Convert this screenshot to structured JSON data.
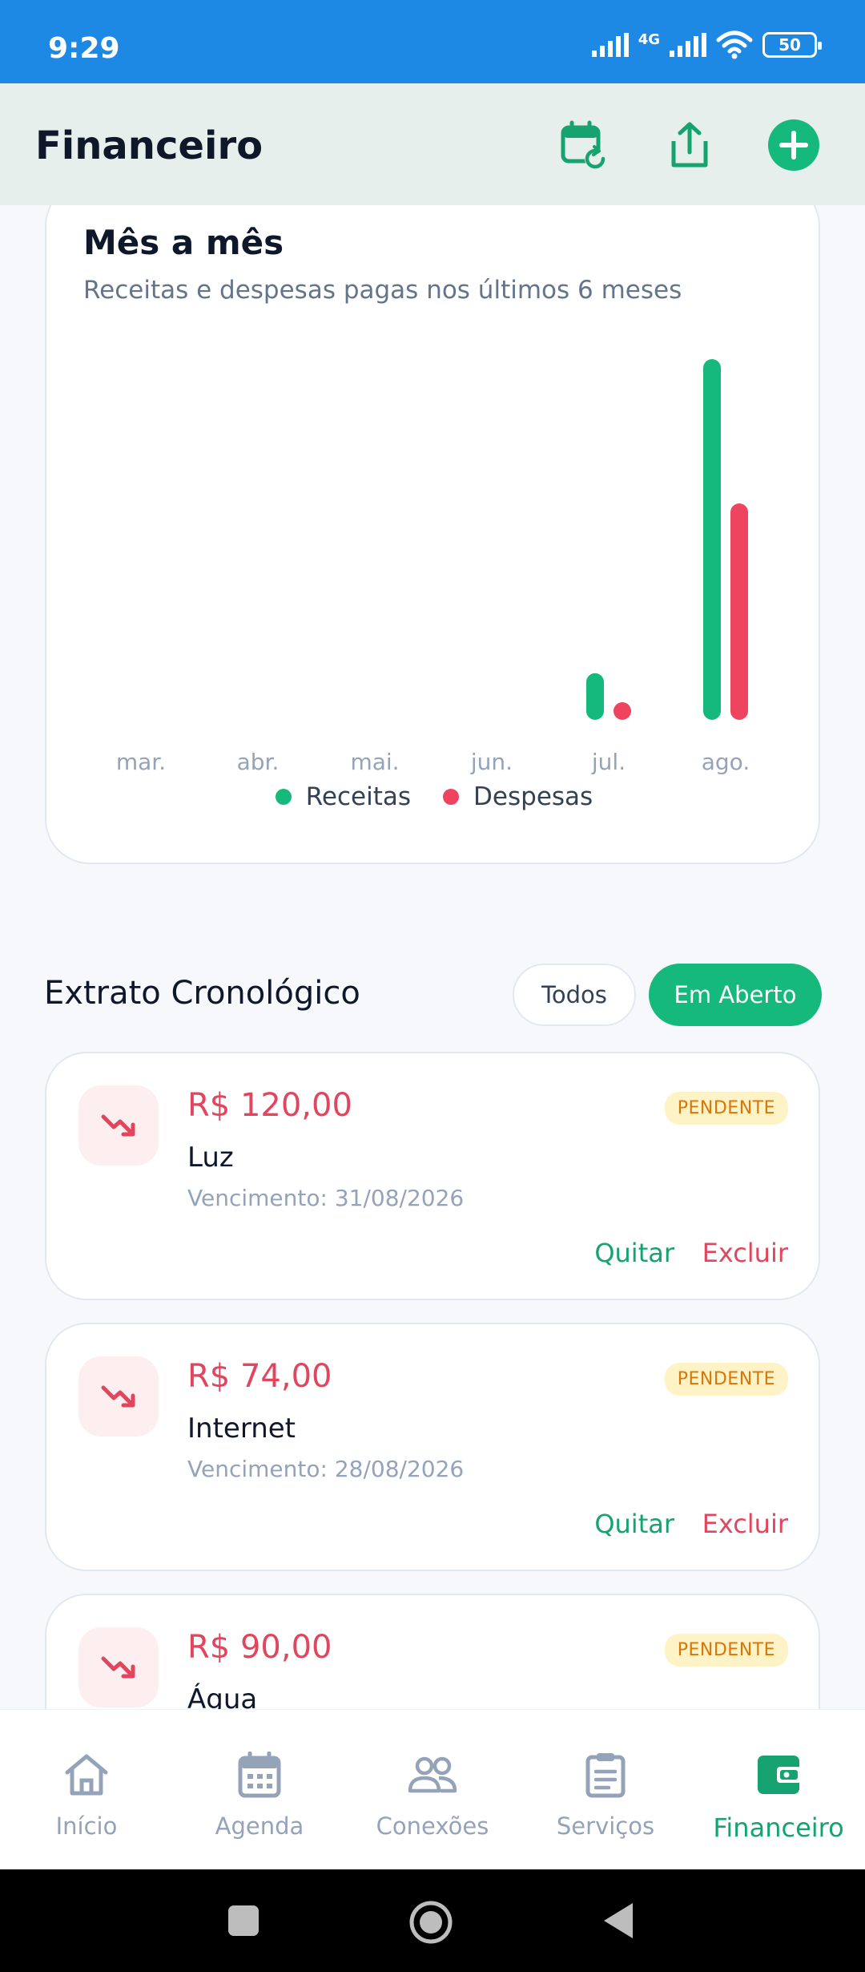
{
  "status_bar": {
    "time": "9:29",
    "network": "4G",
    "battery": "50"
  },
  "header": {
    "title": "Financeiro"
  },
  "chart_card": {
    "title": "Mês a mês",
    "subtitle": "Receitas e despesas pagas nos últimos 6 meses"
  },
  "chart_data": {
    "type": "bar",
    "categories": [
      "mar.",
      "abr.",
      "mai.",
      "jun.",
      "jul.",
      "ago."
    ],
    "series": [
      {
        "name": "Receitas",
        "color": "#16b97c",
        "values": [
          0,
          0,
          0,
          0,
          220,
          1700
        ]
      },
      {
        "name": "Despesas",
        "color": "#ee4460",
        "values": [
          0,
          0,
          0,
          0,
          60,
          1020
        ]
      }
    ],
    "ylim": [
      0,
      1700
    ],
    "grid": false,
    "legend_position": "bottom"
  },
  "extrato": {
    "title": "Extrato Cronológico",
    "filters": {
      "todos": "Todos",
      "em_aberto": "Em Aberto"
    },
    "items": [
      {
        "amount": "R$ 120,00",
        "name": "Luz",
        "due": "Vencimento: 31/08/2026",
        "status": "PENDENTE",
        "quitar": "Quitar",
        "excluir": "Excluir"
      },
      {
        "amount": "R$ 74,00",
        "name": "Internet",
        "due": "Vencimento: 28/08/2026",
        "status": "PENDENTE",
        "quitar": "Quitar",
        "excluir": "Excluir"
      },
      {
        "amount": "R$ 90,00",
        "name": "Água",
        "due": "",
        "status": "PENDENTE",
        "quitar": "",
        "excluir": ""
      }
    ]
  },
  "bottom_nav": [
    {
      "label": "Início",
      "icon": "home-icon"
    },
    {
      "label": "Agenda",
      "icon": "calendar-icon"
    },
    {
      "label": "Conexões",
      "icon": "people-icon"
    },
    {
      "label": "Serviços",
      "icon": "clipboard-icon"
    },
    {
      "label": "Financeiro",
      "icon": "wallet-icon",
      "active": true
    }
  ],
  "colors": {
    "accent": "#16b97c",
    "expense": "#e0475e",
    "status_bar": "#1e88e5",
    "header_bg": "#e6efec"
  }
}
